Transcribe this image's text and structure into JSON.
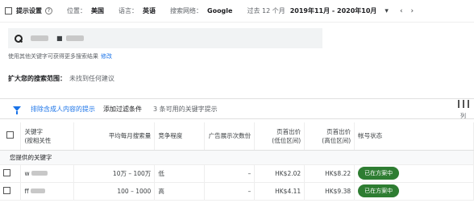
{
  "header": {
    "title": "提示设置",
    "location_label": "位置：",
    "location_value": "美国",
    "language_label": "语言：",
    "language_value": "英语",
    "network_label": "搜索网络：",
    "network_value": "Google",
    "period_label": "过去 12 个月",
    "period_value": "2019年11月 - 2020年10月"
  },
  "search": {
    "chip_separator": "■"
  },
  "hint": {
    "text": "使用其他关键字可获得更多搜索结果",
    "link": "修改"
  },
  "expand": {
    "label": "扩大您的搜索范围：",
    "value": "未找到任何建议"
  },
  "filters": {
    "exclude_adult": "排除含成人内容的提示",
    "add_filter": "添加过滤条件",
    "count_text": "3 条可用的关键字提示",
    "columns_label": "列"
  },
  "table": {
    "columns": [
      "关键字\n(按相关性",
      "平均每月搜索量",
      "竞争程度",
      "广告展示次数份",
      "页首出价\n(低位区间)",
      "页首出价\n(高位区间)",
      "帐号状态"
    ],
    "group_label": "您提供的关键字",
    "rows": [
      {
        "keyword": "w",
        "volume": "10万 – 100万",
        "competition": "低",
        "impressions": "–",
        "low_bid": "HK$2.02",
        "high_bid": "HK$8.22",
        "status": "已在方案中"
      },
      {
        "keyword": "ff",
        "volume": "100 – 1000",
        "competition": "高",
        "impressions": "–",
        "low_bid": "HK$4.11",
        "high_bid": "HK$9.38",
        "status": "已在方案中"
      }
    ]
  }
}
